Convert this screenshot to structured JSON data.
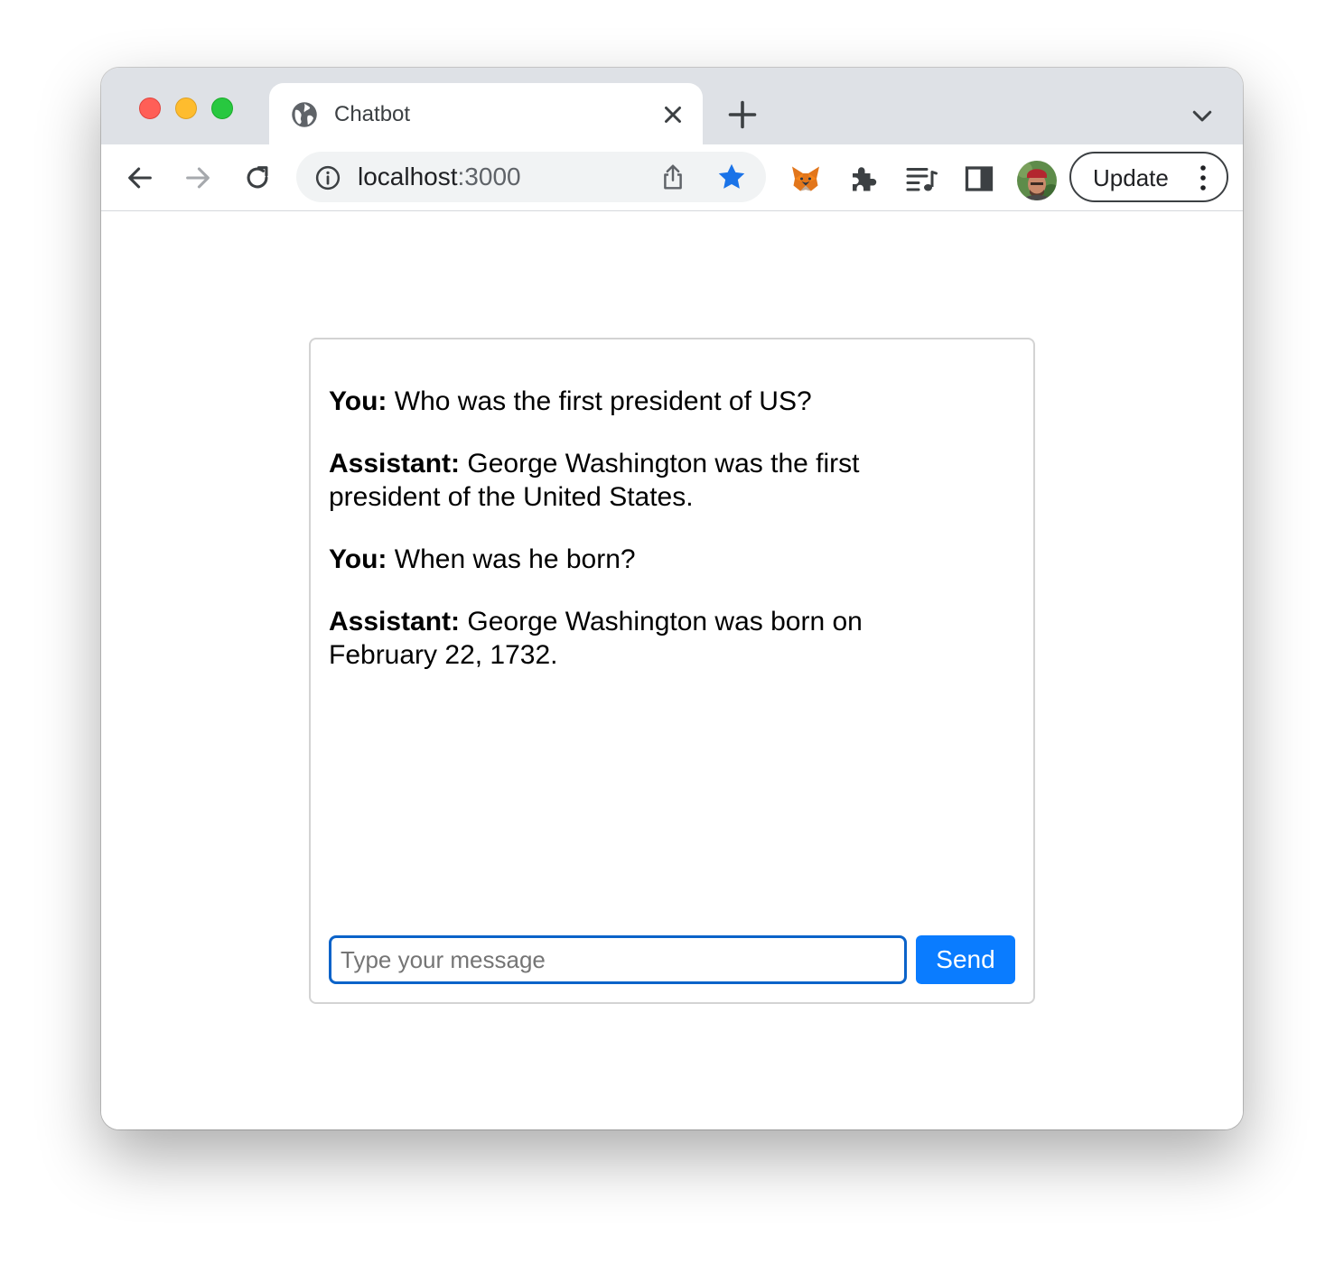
{
  "browser": {
    "tab": {
      "title": "Chatbot"
    },
    "address_bar": {
      "host": "localhost",
      "port": ":3000"
    },
    "update_button": {
      "label": "Update"
    },
    "accent_color": "#1a73e8"
  },
  "chat": {
    "messages": [
      {
        "speaker": "You:",
        "text": " Who was the first president of US?"
      },
      {
        "speaker": "Assistant:",
        "text": " George Washington was the first president of the United States."
      },
      {
        "speaker": "You:",
        "text": " When was he born?"
      },
      {
        "speaker": "Assistant:",
        "text": " George Washington was born on February 22, 1732."
      }
    ],
    "input": {
      "placeholder": "Type your message",
      "value": ""
    },
    "send_label": "Send",
    "send_color": "#0a7cff"
  }
}
